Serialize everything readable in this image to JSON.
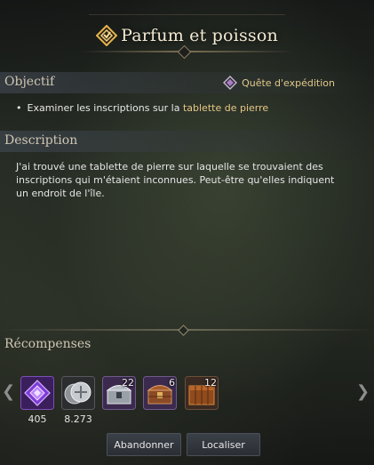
{
  "quest": {
    "title": "Parfum et poisson"
  },
  "objective": {
    "label": "Objectif",
    "quest_type": "Quête d'expédition",
    "items": [
      {
        "prefix": "Examiner les inscriptions sur la ",
        "highlight": "tablette de pierre"
      }
    ]
  },
  "description": {
    "label": "Description",
    "text": "J'ai trouvé une tablette de pierre sur laquelle se trouvaient des inscriptions qui m'étaient inconnues. Peut-être qu'elles indiquent un endroit de l'île."
  },
  "rewards": {
    "label": "Récompenses",
    "items": [
      {
        "icon": "purple-gem-icon",
        "value": "405"
      },
      {
        "icon": "silver-coin-icon",
        "value": "8.273"
      },
      {
        "icon": "silver-chest-icon",
        "qty": "22"
      },
      {
        "icon": "wooden-chest-icon",
        "qty": "6"
      },
      {
        "icon": "treasure-box-icon",
        "qty": "12"
      }
    ]
  },
  "buttons": {
    "abandon": "Abandonner",
    "locate": "Localiser"
  },
  "colors": {
    "accent_gold": "#e7c785",
    "title": "#f2e8d2",
    "section_label": "#cfc6b4"
  }
}
